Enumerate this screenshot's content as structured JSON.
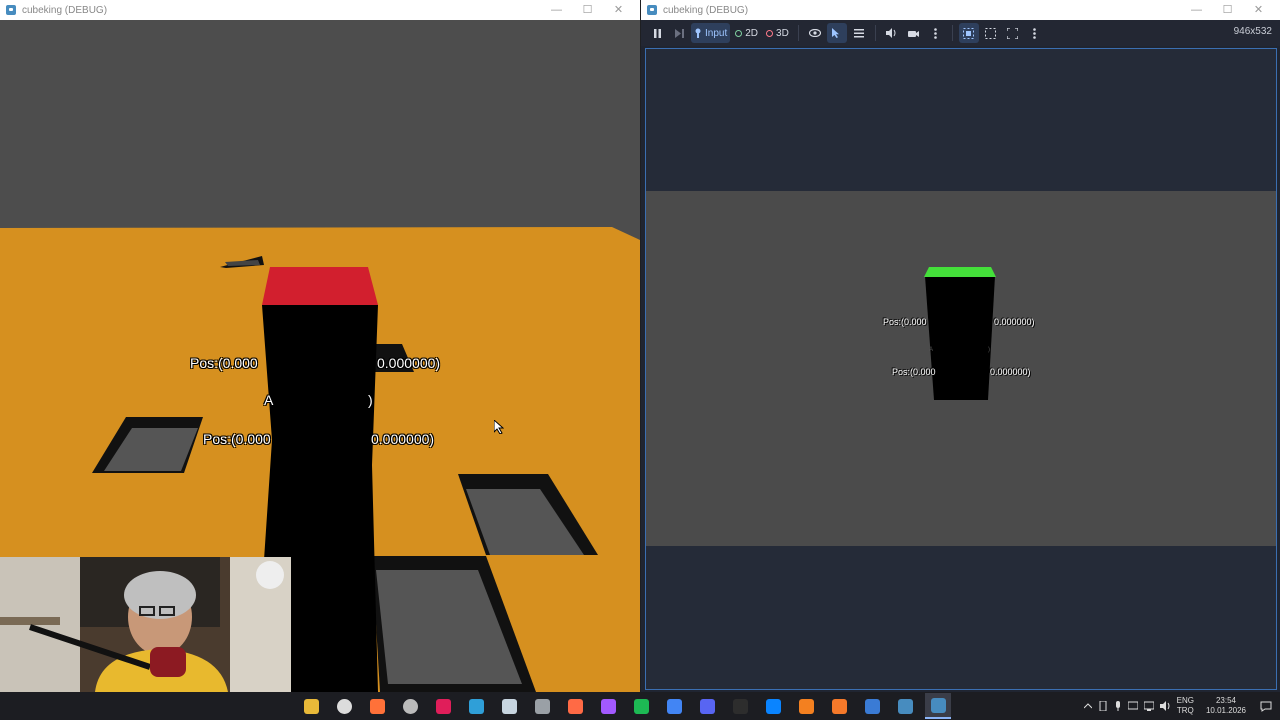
{
  "left_window": {
    "title": "cubeking (DEBUG)",
    "labels": {
      "pos_top_left": "Pos:(0.000",
      "pos_top_right": "0.000000)",
      "pos_bottom_left": "Pos:(0.000",
      "pos_bottom_right": "0.000000)",
      "mid_partial_left": "A",
      "mid_partial_right": ")"
    },
    "colors": {
      "floor": "#d6901f",
      "sky": "#4d4d4d",
      "cube_top": "#d21f2e",
      "cube": "#000000",
      "hole": "#555555"
    }
  },
  "right_window": {
    "title": "cubeking (DEBUG)",
    "toolbar": {
      "input_label": "Input",
      "mode_2d": "2D",
      "mode_3d": "3D",
      "resolution": "946x532"
    },
    "labels": {
      "pos_top_left": "Pos:(0.000",
      "pos_top_right": "0.000000)",
      "pos_bottom_left": "Pos:(0.000",
      "pos_bottom_right": "0.000000)"
    },
    "colors": {
      "cube_top": "#44e03a",
      "floor": "#4b4b4b"
    }
  },
  "window_controls": {
    "minimize": "—",
    "maximize": "☐",
    "close": "✕"
  },
  "taskbar": {
    "icons": [
      "folder-icon",
      "clock-icon",
      "firefox-icon",
      "obs-icon",
      "slack-icon",
      "browser-icon",
      "steam-icon",
      "unity-icon",
      "git-icon",
      "figma-icon",
      "spotify-icon",
      "chrome-icon",
      "discord-icon",
      "terminal-icon",
      "vscode-icon",
      "cloudflare-icon",
      "blender-icon",
      "affinity-icon",
      "godot-icon",
      "godot-debug-icon"
    ],
    "lang_top": "ENG",
    "lang_bottom": "TRQ",
    "time": "23:54",
    "date": "10.01.2026"
  }
}
